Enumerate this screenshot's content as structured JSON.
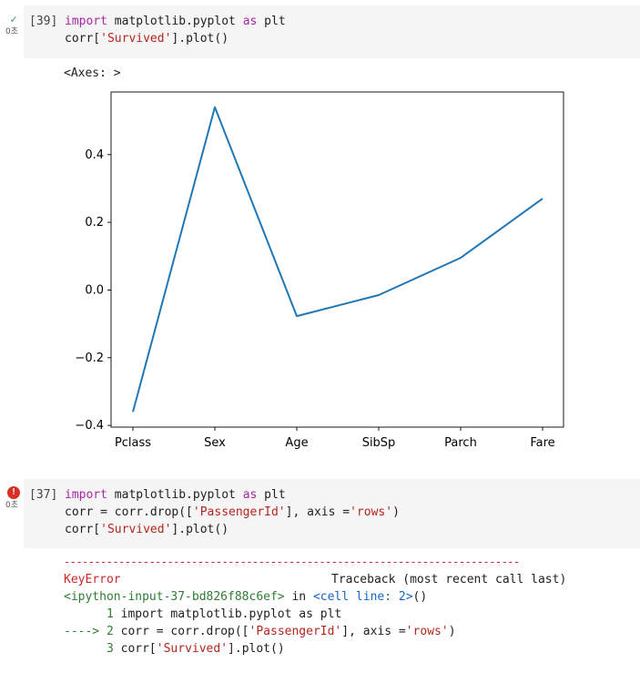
{
  "cells": [
    {
      "status": "success",
      "status_icon": "check-icon",
      "exec_time": "0초",
      "exec_count": "[39]",
      "code": {
        "line1": {
          "import": "import",
          "mod": " matplotlib.pyplot ",
          "as": "as",
          "alias": " plt"
        },
        "line2": {
          "pre": "corr[",
          "str": "'Survived'",
          "post": "].plot()"
        }
      },
      "output_text": "<Axes: >"
    },
    {
      "status": "error",
      "status_icon": "error-icon",
      "exec_time": "0초",
      "exec_count": "[37]",
      "code": {
        "line1": {
          "import": "import",
          "mod": " matplotlib.pyplot ",
          "as": "as",
          "alias": " plt"
        },
        "line2": {
          "pre": "corr = corr.drop([",
          "str1": "'PassengerId'",
          "mid": "], axis =",
          "str2": "'rows'",
          "post": ")"
        },
        "line3": {
          "pre": "corr[",
          "str": "'Survived'",
          "post": "].plot()"
        }
      },
      "traceback": {
        "separator": "---------------------------------------------------------------------------",
        "error_name": "KeyError",
        "traceback_label": "Traceback (most recent call last)",
        "input_ref": "<ipython-input-37-bd826f88c6ef>",
        "in_word": " in ",
        "cell_ref": "<cell line: 2>",
        "cell_ref_post": "()",
        "lines": [
          {
            "marker": "      1 ",
            "text": "import matplotlib.pyplot as plt"
          },
          {
            "marker": "----> 2 ",
            "pre": "corr = corr.drop([",
            "str1": "'PassengerId'",
            "mid": "], axis =",
            "str2": "'rows'",
            "post": ")"
          },
          {
            "marker": "      3 ",
            "pre": "corr[",
            "str": "'Survived'",
            "post": "].plot()"
          }
        ]
      }
    }
  ],
  "chart_data": {
    "type": "line",
    "categories": [
      "Pclass",
      "Sex",
      "Age",
      "SibSp",
      "Parch",
      "Fare"
    ],
    "series": [
      {
        "values": [
          -0.36,
          0.54,
          -0.077,
          -0.015,
          0.095,
          0.27
        ],
        "color": "#1f77b4"
      }
    ],
    "yticks": [
      -0.4,
      -0.2,
      0.0,
      0.2,
      0.4
    ],
    "ytick_labels": [
      "−0.4",
      "−0.2",
      "0.0",
      "0.2",
      "0.4"
    ],
    "ylim": [
      -0.405,
      0.585
    ],
    "title": "",
    "xlabel": "",
    "ylabel": "",
    "grid": false,
    "legend": false
  }
}
